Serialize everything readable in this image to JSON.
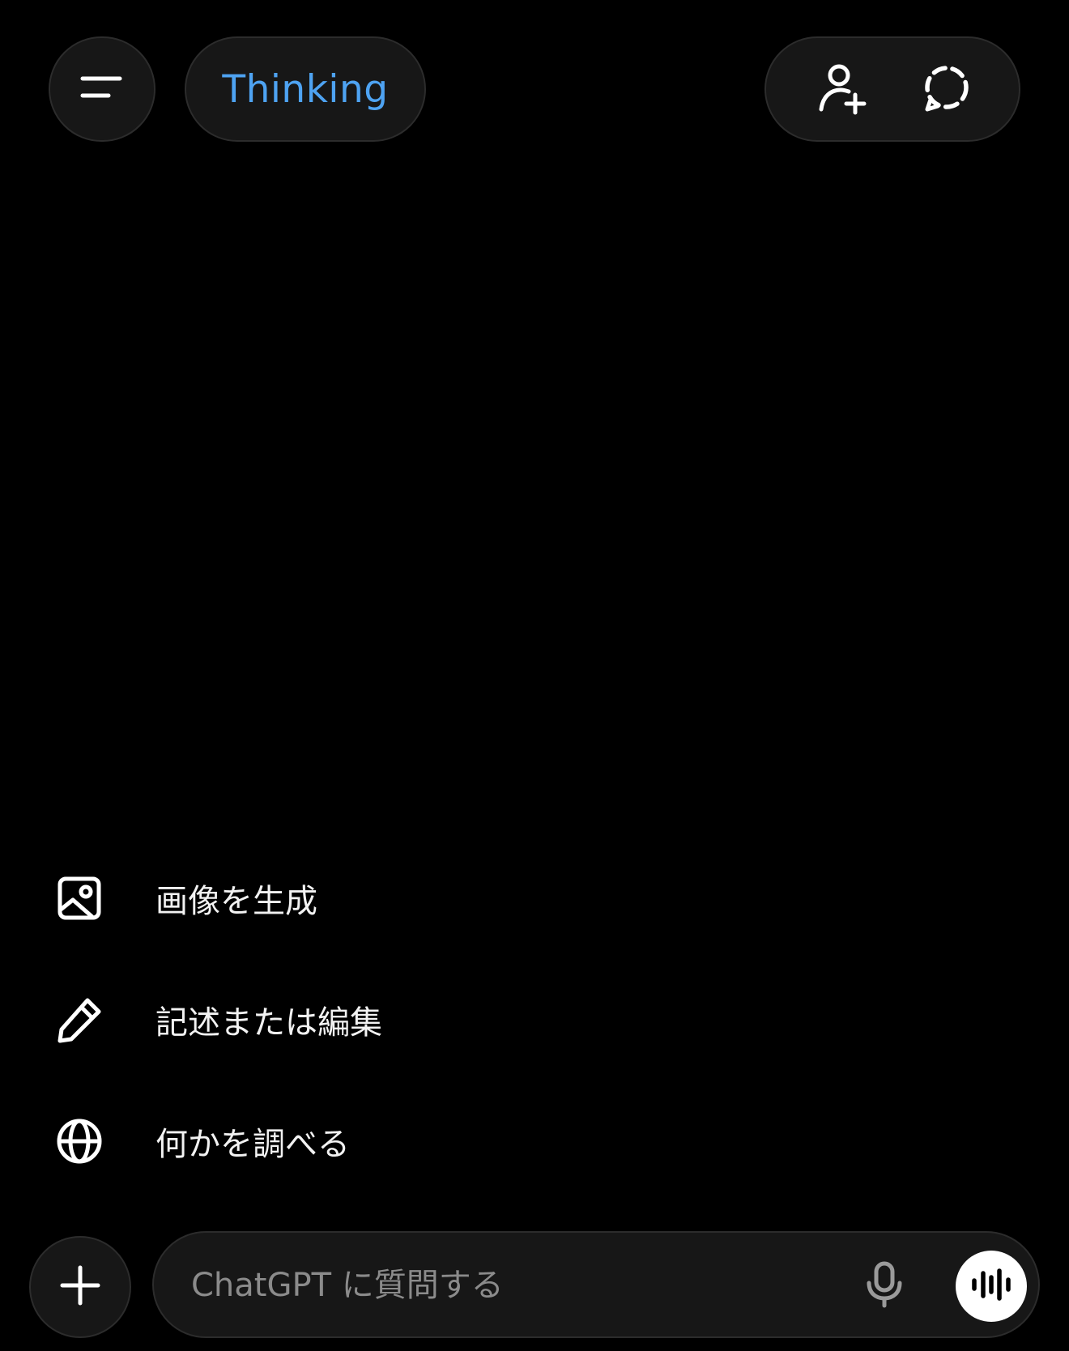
{
  "header": {
    "model_label": "Thinking",
    "model_color": "#4ea3f2",
    "menu_icon": "menu-icon",
    "add_person_icon": "add-person-icon",
    "temporary_chat_icon": "temporary-chat-icon"
  },
  "suggestions": [
    {
      "label": "画像を生成",
      "icon": "image-icon"
    },
    {
      "label": "記述または編集",
      "icon": "pencil-icon"
    },
    {
      "label": "何かを調べる",
      "icon": "globe-icon"
    }
  ],
  "composer": {
    "placeholder": "ChatGPT に質問する",
    "value": "",
    "plus_icon": "plus-icon",
    "mic_icon": "microphone-icon",
    "voice_icon": "voice-mode-icon"
  }
}
